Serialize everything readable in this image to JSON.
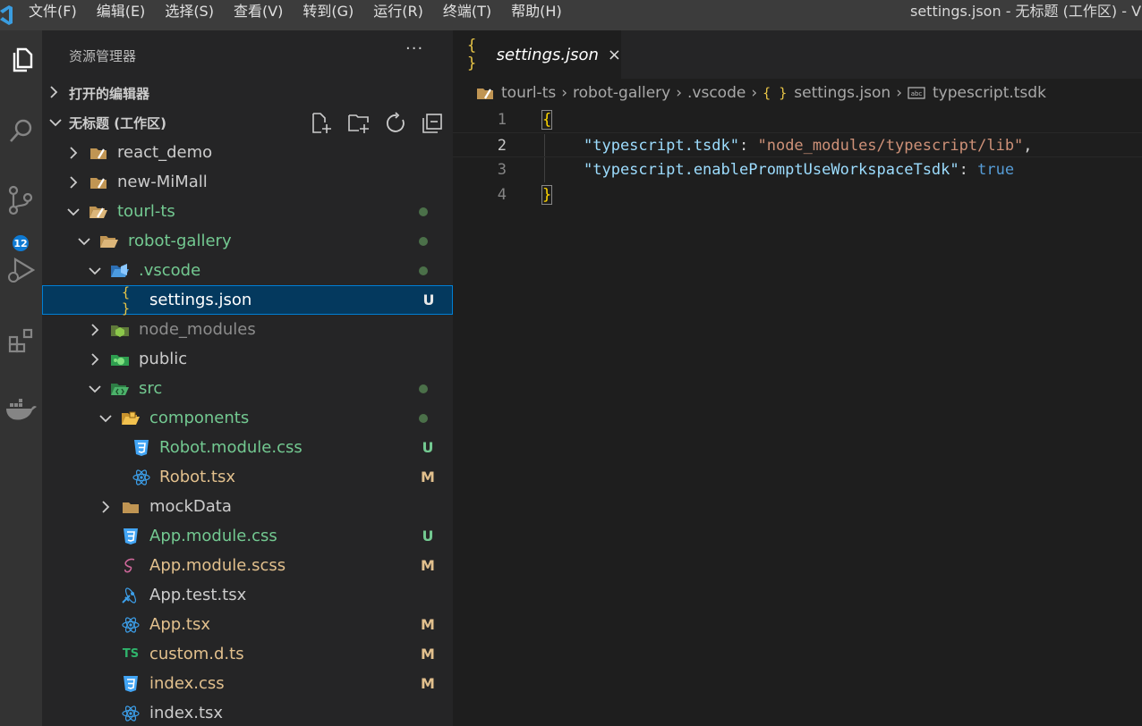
{
  "menu": [
    "文件(F)",
    "编辑(E)",
    "选择(S)",
    "查看(V)",
    "转到(G)",
    "运行(R)",
    "终端(T)",
    "帮助(H)"
  ],
  "window_title": "settings.json - 无标题 (工作区) - V",
  "activity": {
    "scm_badge": "12"
  },
  "sidebar": {
    "header": "资源管理器",
    "more": "···",
    "open_editors": "打开的编辑器",
    "workspace": "无标题 (工作区)"
  },
  "tree": [
    {
      "name": "react_demo",
      "status": ""
    },
    {
      "name": "new-MiMall",
      "status": ""
    },
    {
      "name": "tourl-ts",
      "status": ""
    },
    {
      "name": "robot-gallery",
      "status": ""
    },
    {
      "name": ".vscode",
      "status": ""
    },
    {
      "name": "settings.json",
      "status": "U"
    },
    {
      "name": "node_modules",
      "status": ""
    },
    {
      "name": "public",
      "status": ""
    },
    {
      "name": "src",
      "status": ""
    },
    {
      "name": "components",
      "status": ""
    },
    {
      "name": "Robot.module.css",
      "status": "U"
    },
    {
      "name": "Robot.tsx",
      "status": "M"
    },
    {
      "name": "mockData",
      "status": ""
    },
    {
      "name": "App.module.css",
      "status": "U"
    },
    {
      "name": "App.module.scss",
      "status": "M"
    },
    {
      "name": "App.test.tsx",
      "status": ""
    },
    {
      "name": "App.tsx",
      "status": "M"
    },
    {
      "name": "custom.d.ts",
      "status": "M"
    },
    {
      "name": "index.css",
      "status": "M"
    },
    {
      "name": "index.tsx",
      "status": ""
    }
  ],
  "tab": {
    "icon": "{ }",
    "label": "settings.json",
    "close": "×"
  },
  "breadcrumb": [
    "tourl-ts",
    "robot-gallery",
    ".vscode",
    "settings.json",
    "typescript.tsdk"
  ],
  "breadcrumb_json_icon": "{ }",
  "code": {
    "line_numbers": [
      "1",
      "2",
      "3",
      "4"
    ],
    "open_brace": "{",
    "close_brace": "}",
    "key1": "\"typescript.tsdk\"",
    "colon": ": ",
    "val1": "\"node_modules/typescript/lib\"",
    "comma": ",",
    "key2": "\"typescript.enablePromptUseWorkspaceTsdk\"",
    "val2": "true"
  },
  "colors": {
    "accent": "#007fd4",
    "untracked": "#73c991",
    "modified": "#e2c08d",
    "badge": "#0e7ad3"
  }
}
